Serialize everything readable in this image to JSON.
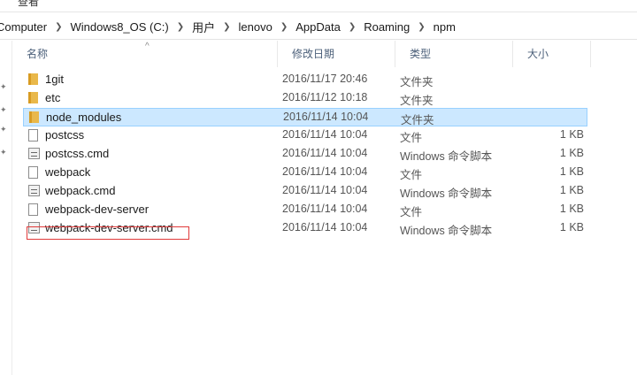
{
  "ribbon": {
    "view_label": "查看"
  },
  "breadcrumb": [
    "Computer",
    "Windows8_OS (C:)",
    "用户",
    "lenovo",
    "AppData",
    "Roaming",
    "npm"
  ],
  "columns": {
    "name": "名称",
    "date": "修改日期",
    "type": "类型",
    "size": "大小"
  },
  "files": [
    {
      "name": "1git",
      "date": "2016/11/17 20:46",
      "type": "文件夹",
      "size": "",
      "kind": "folder",
      "selected": false
    },
    {
      "name": "etc",
      "date": "2016/11/12 10:18",
      "type": "文件夹",
      "size": "",
      "kind": "folder",
      "selected": false
    },
    {
      "name": "node_modules",
      "date": "2016/11/14 10:04",
      "type": "文件夹",
      "size": "",
      "kind": "folder",
      "selected": true
    },
    {
      "name": "postcss",
      "date": "2016/11/14 10:04",
      "type": "文件",
      "size": "1 KB",
      "kind": "file",
      "selected": false
    },
    {
      "name": "postcss.cmd",
      "date": "2016/11/14 10:04",
      "type": "Windows 命令脚本",
      "size": "1 KB",
      "kind": "cmd",
      "selected": false
    },
    {
      "name": "webpack",
      "date": "2016/11/14 10:04",
      "type": "文件",
      "size": "1 KB",
      "kind": "file",
      "selected": false
    },
    {
      "name": "webpack.cmd",
      "date": "2016/11/14 10:04",
      "type": "Windows 命令脚本",
      "size": "1 KB",
      "kind": "cmd",
      "selected": false
    },
    {
      "name": "webpack-dev-server",
      "date": "2016/11/14 10:04",
      "type": "文件",
      "size": "1 KB",
      "kind": "file",
      "selected": false
    },
    {
      "name": "webpack-dev-server.cmd",
      "date": "2016/11/14 10:04",
      "type": "Windows 命令脚本",
      "size": "1 KB",
      "kind": "cmd",
      "selected": false
    }
  ],
  "colors": {
    "selection": "#cce8ff",
    "selection_border": "#99d1ff",
    "annotation": "#e03a3a",
    "header_text": "#4c607a"
  },
  "icons": {
    "folder": "folder-icon",
    "file": "file-icon",
    "cmd": "cmd-script-icon",
    "separator": "chevron-right-icon",
    "sort": "sort-up-icon",
    "pin": "pin-icon"
  }
}
